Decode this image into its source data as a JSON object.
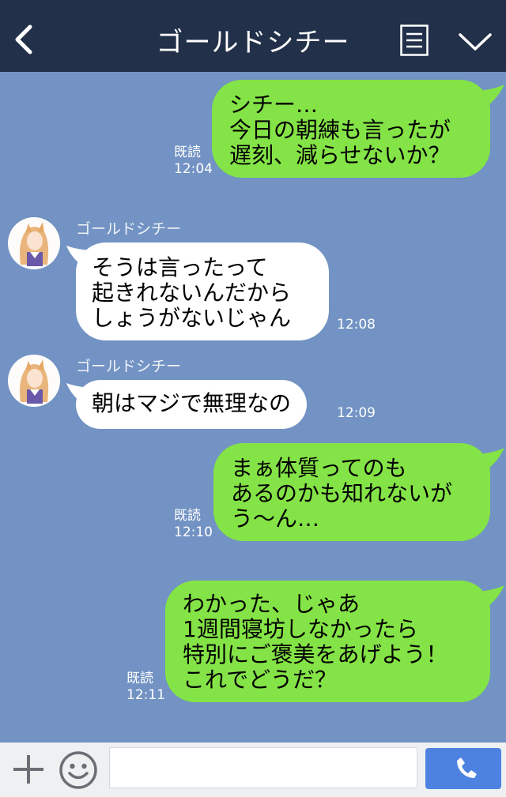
{
  "header": {
    "title": "ゴールドシチー",
    "icons": {
      "back": "chevron-left-icon",
      "menu": "document-list-icon",
      "collapse": "chevron-down-icon"
    }
  },
  "colors": {
    "header_bg": "#22304a",
    "chat_bg": "#7293c3",
    "my_bubble": "#84e346",
    "their_bubble": "#ffffff",
    "call_button": "#4d82e0"
  },
  "messages": [
    {
      "from": "me",
      "text": "シチー…\n今日の朝練も言ったが\n遅刻、減らせないか？",
      "read": "既読",
      "time": "12:04"
    },
    {
      "from": "them",
      "sender": "ゴールドシチー",
      "text": "そうは言ったって\n起きれないんだから\nしょうがないじゃん",
      "time": "12:08"
    },
    {
      "from": "them",
      "sender": "ゴールドシチー",
      "text": "朝はマジで無理なの",
      "time": "12:09"
    },
    {
      "from": "me",
      "text": "まぁ体質ってのも\nあるのかも知れないが\nう～ん…",
      "read": "既読",
      "time": "12:10"
    },
    {
      "from": "me",
      "text": "わかった、じゃあ\n1週間寝坊しなかったら\n特別にご褒美をあげよう！\nこれでどうだ？",
      "read": "既読",
      "time": "12:11"
    }
  ],
  "footer": {
    "input_value": "",
    "icons": {
      "add": "plus-icon",
      "emoji": "smiley-icon",
      "call": "phone-icon"
    }
  }
}
